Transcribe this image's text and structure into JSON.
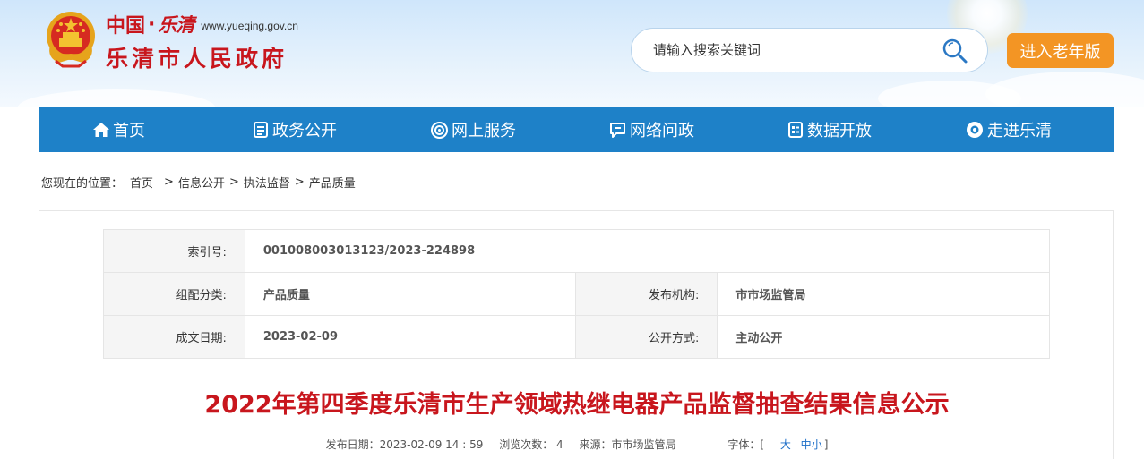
{
  "header": {
    "logo_cn": "中国",
    "logo_dot": "·",
    "logo_calligraphy": "乐清",
    "logo_url": "www.yueqing.gov.cn",
    "logo_main": "乐清市人民政府",
    "search_placeholder": "请输入搜索关键词",
    "elder_mode_label": "进入老年版"
  },
  "nav": {
    "items": [
      {
        "label": "首页",
        "icon": "home-icon"
      },
      {
        "label": "政务公开",
        "icon": "document-icon"
      },
      {
        "label": "网上服务",
        "icon": "service-icon"
      },
      {
        "label": "网络问政",
        "icon": "chat-icon"
      },
      {
        "label": "数据开放",
        "icon": "data-icon"
      },
      {
        "label": "走进乐清",
        "icon": "eye-icon"
      }
    ]
  },
  "breadcrumb": {
    "prefix": "您现在的位置：",
    "items": [
      "首页",
      "信息公开",
      "执法监督",
      "产品质量"
    ],
    "separator": ">"
  },
  "meta": {
    "index_label": "索引号:",
    "index_value": "001008003013123/2023-224898",
    "category_label": "组配分类:",
    "category_value": "产品质量",
    "publisher_label": "发布机构:",
    "publisher_value": "市市场监管局",
    "date_label": "成文日期:",
    "date_value": "2023-02-09",
    "disclosure_label": "公开方式:",
    "disclosure_value": "主动公开"
  },
  "article": {
    "title": "2022年第四季度乐清市生产领域热继电器产品监督抽查结果信息公示",
    "publish_date": "发布日期：2023-02-09 14 : 59",
    "views": "浏览次数： 4",
    "source": "来源：市市场监管局",
    "font_size_label": "字体：[",
    "font_large": "大",
    "font_medium": "中",
    "font_small": "小",
    "font_close": "]"
  },
  "colors": {
    "brand_red": "#c8161d",
    "nav_blue": "#1e81c8",
    "elder_orange": "#f39524"
  }
}
